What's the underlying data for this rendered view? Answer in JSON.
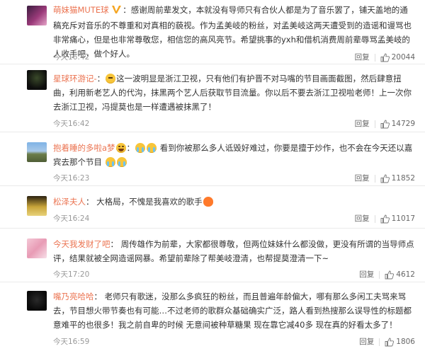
{
  "icons": {
    "thumb": "thumbs-up-icon",
    "vip": "verified-v-icon"
  },
  "colors": {
    "username": "#eb7350",
    "time": "#999999",
    "accent_vip": "#f5a623"
  },
  "comments": [
    {
      "user": "萌妹猫MUTE球",
      "text": "感谢周前辈发文，本就没有导师只有合伙人都是为了音乐罢了，铺天盖地的通稿充斥对音乐的不尊重和对真相的藐视。作为孟美岐的粉丝，对孟美岐这两天遭受到的造谣和谩骂也非常痛心，但是也非常尊敬您，相信您的高风亮节。希望挑事的yxh和借机消费周前辈辱骂孟美岐的人收手吧，做个好人。",
      "time": "今天16:42",
      "reply": "回复",
      "likes": "20044"
    },
    {
      "user": "星球环游记-",
      "text": "这一波明显是浙江卫视，只有他们有护晋不对马嘴的节目画面截图，然后肆意扭曲，利用新老艺人的代沟，抹黑两个艺人后获取节目流量。你以后不要去浙江卫视啦老师！上一次你去浙江卫视，冯提莫也是一样遭遇被抹黑了！",
      "time": "今天16:42",
      "reply": "回复",
      "likes": "14729"
    },
    {
      "user": "抱着睡的多啦a梦",
      "text": "看到你被那么多人诋毁好难过，你要是擅于炒作，也不会在今天还以嘉宾去那个节目",
      "time": "今天16:23",
      "reply": "回复",
      "likes": "11852"
    },
    {
      "user": "松泽夫人",
      "text": "大格局，不愧是我喜欢的歌手",
      "time": "今天16:24",
      "reply": "回复",
      "likes": "11017"
    },
    {
      "user": "今天我发财了吧",
      "text": "周传雄作为前辈，大家都很尊敬，但两位妹妹什么都没做，更没有所谓的当导师点评，结果就被全网造谣网暴。希望前辈除了帮美岐澄清，也帮提莫澄清一下~",
      "time": "今天17:20",
      "reply": "回复",
      "likes": "4612"
    },
    {
      "user": "嘴乃亮哈哈",
      "text": "老师只有歌迷，没那么多疯狂的粉丝，而且普遍年龄偏大，哪有那么多闲工夫骂来骂去，节目想火带节奏也有可能…不过老师的歌群众基础确实广泛，路人看到热搜那么误导性的标题都意难平的也很多！我之前自卑的时候 无意间被种草糖果 现在靠它减40多 现在真的好看太多了！",
      "time": "今天16:59",
      "reply": "回复",
      "likes": "1806"
    }
  ]
}
